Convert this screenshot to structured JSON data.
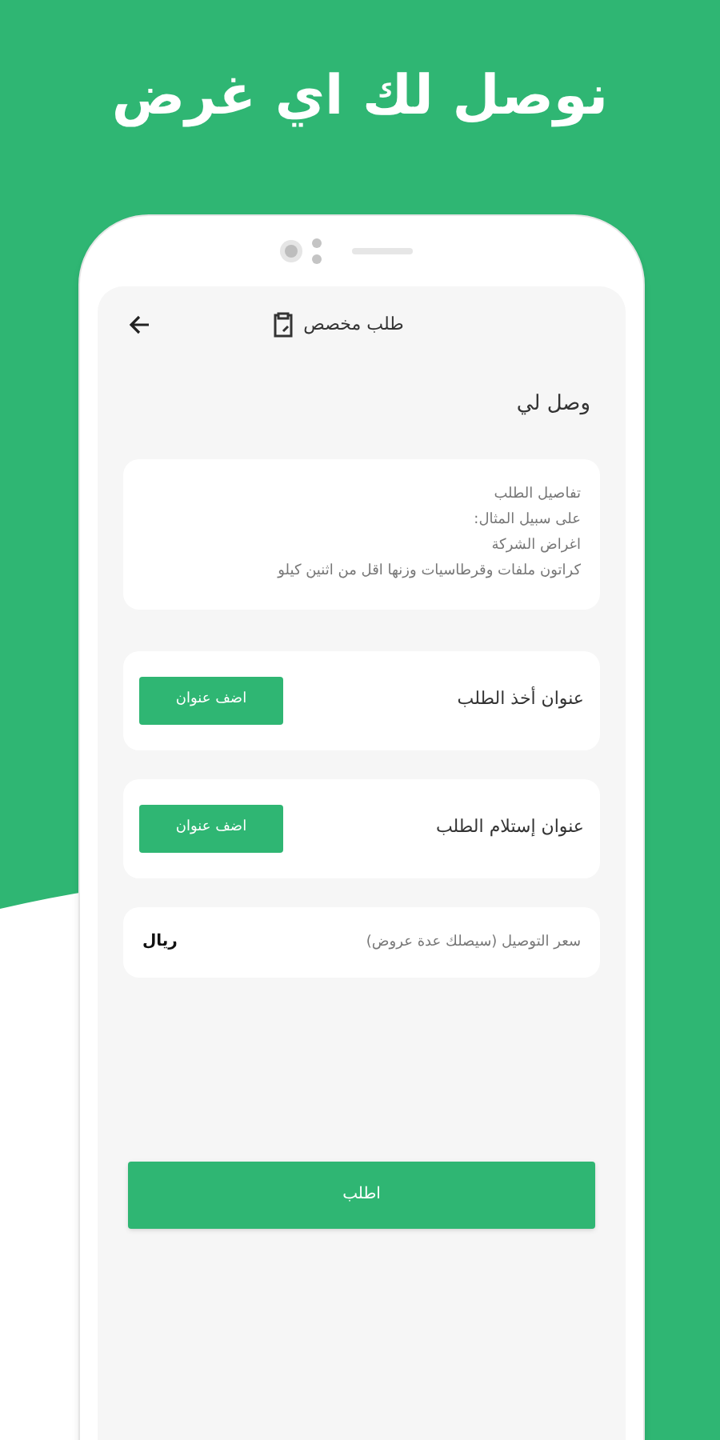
{
  "headline": "نوصل لك اي غرض",
  "app_bar": {
    "title": "طلب مخصص"
  },
  "section_title": "وصل لي",
  "details": {
    "placeholder": "تفاصيل الطلب\nعلى سبيل المثال:\nاغراض الشركة\nكراتون ملفات وقرطاسيات وزنها اقل من اثنين كيلو"
  },
  "addresses": [
    {
      "label": "عنوان أخذ الطلب",
      "button": "اضف عنوان"
    },
    {
      "label": "عنوان إستلام الطلب",
      "button": "اضف عنوان"
    }
  ],
  "price": {
    "placeholder": "سعر التوصيل (سيصلك عدة عروض)",
    "currency": "ريال"
  },
  "submit": "اطلب"
}
